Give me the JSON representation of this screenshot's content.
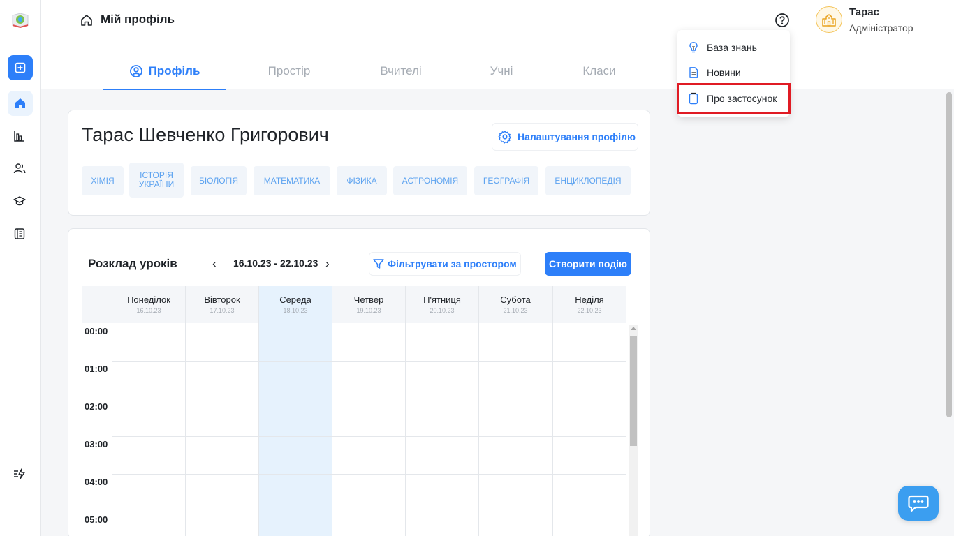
{
  "header": {
    "title": "Мій профіль",
    "user": {
      "name": "Тарас",
      "role": "Адміністратор"
    }
  },
  "tabs": [
    {
      "label": "Профіль",
      "active": true
    },
    {
      "label": "Простір"
    },
    {
      "label": "Вчителі"
    },
    {
      "label": "Учні"
    },
    {
      "label": "Класи"
    }
  ],
  "dropdown": {
    "items": [
      {
        "label": "База знань",
        "icon": "lightbulb-icon"
      },
      {
        "label": "Новини",
        "icon": "document-icon"
      },
      {
        "label": "Про застосунок",
        "icon": "clipboard-icon",
        "highlighted": true
      }
    ]
  },
  "profile": {
    "name": "Тарас Шевченко Григорович",
    "settings_label": "Налаштування профілю",
    "subjects": [
      "Хімія",
      "Історія України",
      "Біологія",
      "Математика",
      "Фізика",
      "Астрономія",
      "Географія",
      "Енциклопедія"
    ]
  },
  "schedule": {
    "title": "Розклад уроків",
    "prev": "‹",
    "next": "›",
    "week_range": "16.10.23 - 22.10.23",
    "filter_label": "Фільтрувати за простором",
    "create_label": "Створити подію",
    "days": [
      {
        "name": "Понеділок",
        "date": "16.10.23"
      },
      {
        "name": "Вівторок",
        "date": "17.10.23"
      },
      {
        "name": "Середа",
        "date": "18.10.23",
        "today": true
      },
      {
        "name": "Четвер",
        "date": "19.10.23"
      },
      {
        "name": "П'ятниця",
        "date": "20.10.23"
      },
      {
        "name": "Субота",
        "date": "21.10.23"
      },
      {
        "name": "Неділя",
        "date": "22.10.23"
      }
    ],
    "hours": [
      "00:00",
      "01:00",
      "02:00",
      "03:00",
      "04:00",
      "05:00"
    ]
  },
  "colors": {
    "accent": "#2d7ff9",
    "highlight": "#e01b24",
    "today": "#e6f2fd"
  }
}
